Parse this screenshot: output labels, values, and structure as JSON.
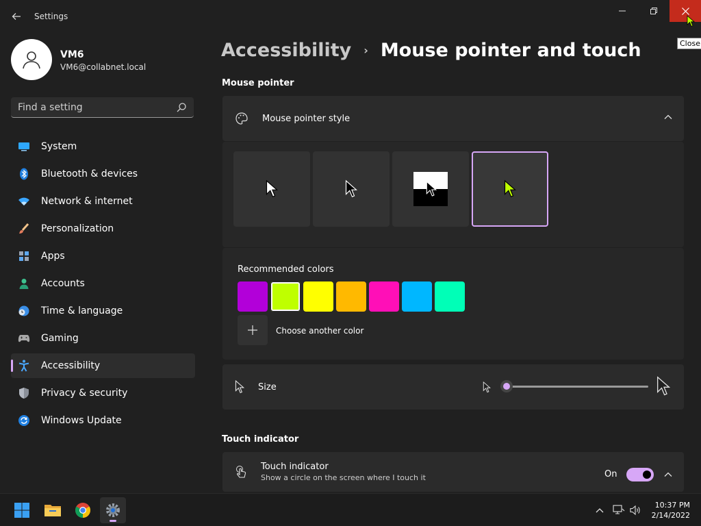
{
  "window": {
    "title": "Settings",
    "tooltip": "Close"
  },
  "profile": {
    "name": "VM6",
    "email": "VM6@collabnet.local"
  },
  "search": {
    "placeholder": "Find a setting"
  },
  "sidebar": {
    "items": [
      {
        "label": "System",
        "icon": "monitor-icon"
      },
      {
        "label": "Bluetooth & devices",
        "icon": "bluetooth-icon"
      },
      {
        "label": "Network & internet",
        "icon": "wifi-icon"
      },
      {
        "label": "Personalization",
        "icon": "brush-icon"
      },
      {
        "label": "Apps",
        "icon": "apps-icon"
      },
      {
        "label": "Accounts",
        "icon": "person-icon"
      },
      {
        "label": "Time & language",
        "icon": "globe-clock-icon"
      },
      {
        "label": "Gaming",
        "icon": "controller-icon"
      },
      {
        "label": "Accessibility",
        "icon": "accessibility-icon",
        "active": true
      },
      {
        "label": "Privacy & security",
        "icon": "shield-icon"
      },
      {
        "label": "Windows Update",
        "icon": "update-icon"
      }
    ]
  },
  "breadcrumb": {
    "parent": "Accessibility",
    "current": "Mouse pointer and touch"
  },
  "mouse_pointer": {
    "section_title": "Mouse pointer",
    "style_label": "Mouse pointer style",
    "styles": [
      "white",
      "black",
      "inverted",
      "custom"
    ],
    "selected_style": 3,
    "recommended_label": "Recommended colors",
    "colors": [
      "#b200d9",
      "#bfff00",
      "#ffff00",
      "#ffb900",
      "#ff0fb7",
      "#00b7ff",
      "#00ffb7"
    ],
    "selected_color": 1,
    "custom_color_label": "Choose another color",
    "size_label": "Size",
    "size_value": 0.0
  },
  "touch": {
    "section_title": "Touch indicator",
    "title": "Touch indicator",
    "description": "Show a circle on the screen where I touch it",
    "state": "On"
  },
  "accent_color": "#d7a7f7",
  "taskbar": {
    "apps": [
      "start-icon",
      "file-explorer-icon",
      "chrome-icon",
      "settings-icon"
    ],
    "time": "10:37 PM",
    "date": "2/14/2022"
  }
}
